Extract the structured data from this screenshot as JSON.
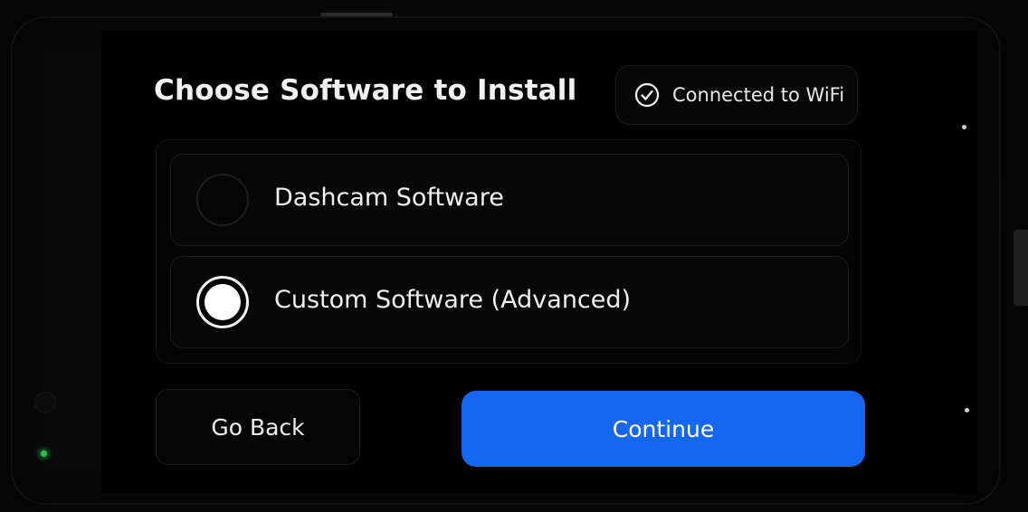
{
  "header": {
    "title": "Choose Software to Install",
    "wifi_status": "Connected to WiFi",
    "wifi_icon": "check-circle-icon"
  },
  "options": [
    {
      "label": "Dashcam Software",
      "selected": false
    },
    {
      "label": "Custom Software (Advanced)",
      "selected": true
    }
  ],
  "buttons": {
    "back_label": "Go Back",
    "continue_label": "Continue"
  },
  "colors": {
    "accent": "#1566f0",
    "background": "#000000",
    "text": "#f0f0f0",
    "led": "#27c24a"
  }
}
